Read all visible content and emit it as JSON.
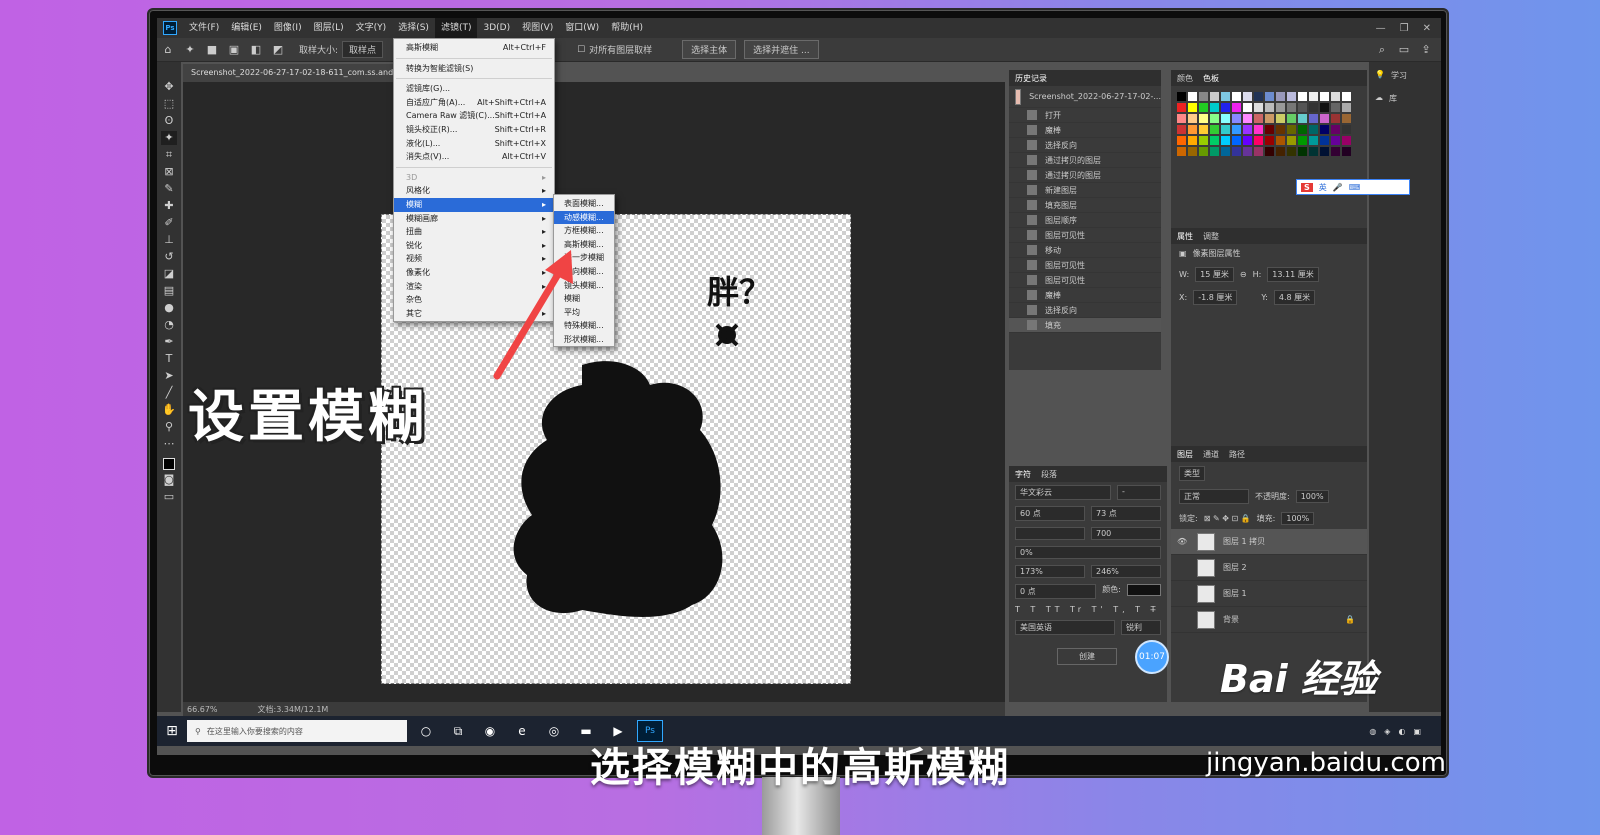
{
  "menubar": {
    "items": [
      "文件(F)",
      "编辑(E)",
      "图像(I)",
      "图层(L)",
      "文字(Y)",
      "选择(S)",
      "滤镜(T)",
      "3D(D)",
      "视图(V)",
      "窗口(W)",
      "帮助(H)"
    ],
    "active_index": 6
  },
  "options_bar": {
    "sample_size_label": "取样大小:",
    "sample_size_value": "取样点",
    "all_layers_label": "对所有图层取样",
    "select_subject": "选择主体",
    "select_and_mask": "选择并遮住 ..."
  },
  "document": {
    "tab_title": "Screenshot_2022-06-27-17-02-18-611_com.ss.android_"
  },
  "status": {
    "zoom": "66.67%",
    "doc_size": "文档:3.34M/12.1M"
  },
  "filter_menu": {
    "items": [
      {
        "label": "高斯模糊",
        "shortcut": "Alt+Ctrl+F"
      },
      {
        "sep": true
      },
      {
        "label": "转换为智能滤镜(S)",
        "shortcut": ""
      },
      {
        "sep": true
      },
      {
        "label": "滤镜库(G)...",
        "shortcut": ""
      },
      {
        "label": "自适应广角(A)...",
        "shortcut": "Alt+Shift+Ctrl+A"
      },
      {
        "label": "Camera Raw 滤镜(C)...",
        "shortcut": "Shift+Ctrl+A"
      },
      {
        "label": "镜头校正(R)...",
        "shortcut": "Shift+Ctrl+R"
      },
      {
        "label": "液化(L)...",
        "shortcut": "Shift+Ctrl+X"
      },
      {
        "label": "消失点(V)...",
        "shortcut": "Alt+Ctrl+V"
      },
      {
        "sep": true
      },
      {
        "label": "3D",
        "shortcut": "▸",
        "dim": true
      },
      {
        "label": "风格化",
        "shortcut": "▸"
      },
      {
        "label": "模糊",
        "shortcut": "▸",
        "highlight": true
      },
      {
        "label": "模糊画廊",
        "shortcut": "▸"
      },
      {
        "label": "扭曲",
        "shortcut": "▸"
      },
      {
        "label": "锐化",
        "shortcut": "▸"
      },
      {
        "label": "视频",
        "shortcut": "▸"
      },
      {
        "label": "像素化",
        "shortcut": "▸"
      },
      {
        "label": "渲染",
        "shortcut": "▸"
      },
      {
        "label": "杂色",
        "shortcut": "▸"
      },
      {
        "label": "其它",
        "shortcut": "▸"
      }
    ]
  },
  "blur_submenu": {
    "items": [
      "表面模糊...",
      "动感模糊...",
      "方框模糊...",
      "高斯模糊...",
      "进一步模糊",
      "径向模糊...",
      "镜头模糊...",
      "模糊",
      "平均",
      "特殊模糊...",
      "形状模糊..."
    ],
    "highlight_index": 1
  },
  "history_panel": {
    "tabs": [
      "历史记录"
    ],
    "snapshot": "Screenshot_2022-06-27-17-02-...",
    "items": [
      "打开",
      "魔棒",
      "选择反向",
      "通过拷贝的图层",
      "通过拷贝的图层",
      "新建图层",
      "填充图层",
      "图层顺序",
      "图层可见性",
      "移动",
      "图层可见性",
      "图层可见性",
      "魔棒",
      "选择反向",
      "填充"
    ],
    "selected_index": 14
  },
  "swatch_panel": {
    "tabs": [
      "颜色",
      "色板"
    ]
  },
  "properties_panel": {
    "tabs": [
      "属性",
      "调整"
    ],
    "title": "像素图层属性",
    "w_label": "W:",
    "w_value": "15 厘米",
    "h_label": "H:",
    "h_value": "13.11 厘米",
    "x_label": "X:",
    "x_value": "-1.8 厘米",
    "y_label": "Y:",
    "y_value": "4.8 厘米"
  },
  "character_panel": {
    "tabs": [
      "字符",
      "段落"
    ],
    "font": "华文彩云",
    "font_style": "-",
    "size": "60 点",
    "leading": "73 点",
    "tracking": "700",
    "scale_pct": "0%",
    "vscale": "173%",
    "hscale": "246%",
    "baseline": "0 点",
    "color_label": "颜色:",
    "lang": "美国英语",
    "aa": "锐利",
    "create_btn": "创建"
  },
  "layers_panel": {
    "tabs": [
      "图层",
      "通道",
      "路径"
    ],
    "kind": "类型",
    "blend": "正常",
    "opacity_label": "不透明度:",
    "opacity": "100%",
    "lock_label": "锁定:",
    "fill_label": "填充:",
    "fill": "100%",
    "layers": [
      {
        "name": "图层 1 拷贝",
        "selected": true,
        "visible": true
      },
      {
        "name": "图层 2",
        "selected": false,
        "visible": false
      },
      {
        "name": "图层 1",
        "selected": false,
        "visible": false
      },
      {
        "name": "背景",
        "selected": false,
        "visible": false,
        "locked": true
      }
    ]
  },
  "far_right": {
    "learn": "学习",
    "library": "库"
  },
  "taskbar": {
    "search_placeholder": "在这里输入你要搜索的内容"
  },
  "ime": {
    "label": "英"
  },
  "timer": "01:07",
  "overlay": {
    "title": "设置模糊",
    "caption": "选择模糊中的高斯模糊",
    "watermark": "Bai 经验",
    "watermark_url": "jingyan.baidu.com"
  },
  "canvas_text": "胖？"
}
